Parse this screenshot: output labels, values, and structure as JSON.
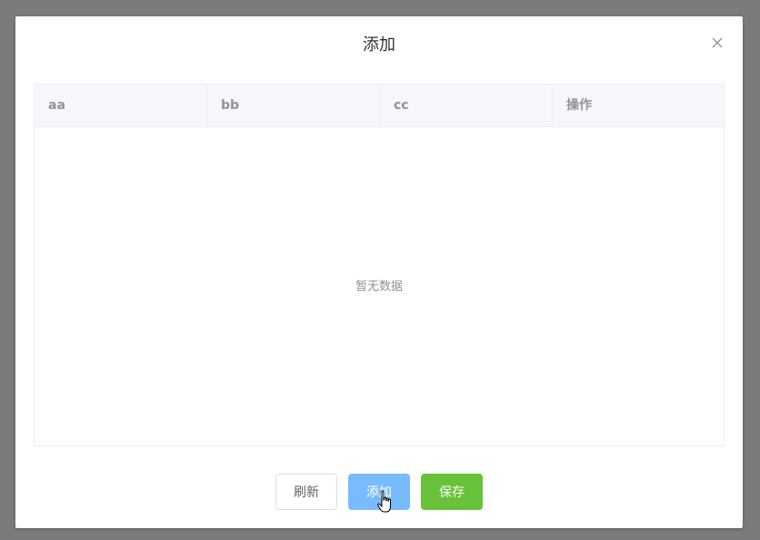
{
  "dialog": {
    "title": "添加",
    "close_icon": "close-icon"
  },
  "table": {
    "columns": [
      "aa",
      "bb",
      "cc",
      "操作"
    ],
    "empty_text": "暂无数据"
  },
  "footer": {
    "refresh_label": "刷新",
    "add_label": "添加",
    "save_label": "保存"
  },
  "colors": {
    "overlay": "#7b7b7b",
    "primary": "#79bbff",
    "success": "#67c23a",
    "header_bg": "#f5f7fa"
  }
}
